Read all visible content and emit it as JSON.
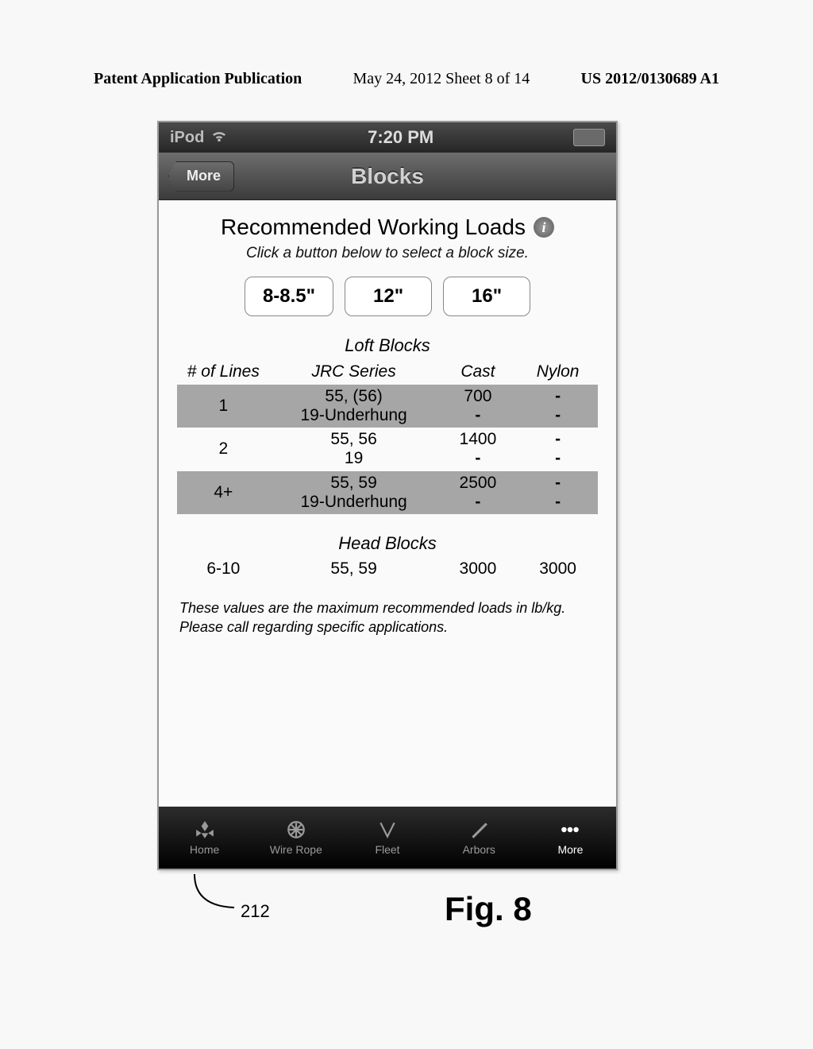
{
  "page_header": {
    "left": "Patent Application Publication",
    "center": "May 24, 2012  Sheet 8 of 14",
    "right": "US 2012/0130689 A1"
  },
  "statusbar": {
    "carrier": "iPod",
    "time": "7:20 PM"
  },
  "navbar": {
    "back": "More",
    "title": "Blocks"
  },
  "heading": "Recommended Working Loads",
  "subtitle": "Click a button below to select a block size.",
  "sizes": {
    "a": "8-8.5\"",
    "b": "12\"",
    "c": "16\""
  },
  "loft": {
    "title": "Loft Blocks",
    "cols": {
      "lines": "# of Lines",
      "jrc": "JRC Series",
      "cast": "Cast",
      "nylon": "Nylon"
    },
    "rows": [
      {
        "lines": "1",
        "jrc": "55, (56)\n19-Underhung",
        "cast_a": "700",
        "cast_b": "-",
        "nylon_a": "-",
        "nylon_b": "-"
      },
      {
        "lines": "2",
        "jrc": "55, 56\n19",
        "cast_a": "1400",
        "cast_b": "-",
        "nylon_a": "-",
        "nylon_b": "-"
      },
      {
        "lines": "4+",
        "jrc": "55, 59\n19-Underhung",
        "cast_a": "2500",
        "cast_b": "-",
        "nylon_a": "-",
        "nylon_b": "-"
      }
    ]
  },
  "head": {
    "title": "Head Blocks",
    "row": {
      "lines": "6-10",
      "jrc": "55, 59",
      "cast": "3000",
      "nylon": "3000"
    }
  },
  "footnote": "These values are the maximum recommended loads in lb/kg.  Please call regarding specific applications.",
  "tabs": {
    "home": "Home",
    "wire": "Wire Rope",
    "fleet": "Fleet",
    "arbors": "Arbors",
    "more": "More"
  },
  "callout": "212",
  "figure": "Fig. 8",
  "chart_data": {
    "type": "table",
    "title": "Recommended Working Loads — 12\" block size",
    "sections": [
      {
        "name": "Loft Blocks",
        "columns": [
          "# of Lines",
          "JRC Series",
          "Cast",
          "Nylon"
        ],
        "rows": [
          [
            "1",
            "55, (56) / 19-Underhung",
            700,
            null
          ],
          [
            "2",
            "55, 56 / 19",
            1400,
            null
          ],
          [
            "4+",
            "55, 59 / 19-Underhung",
            2500,
            null
          ]
        ]
      },
      {
        "name": "Head Blocks",
        "columns": [
          "# of Lines",
          "JRC Series",
          "Cast",
          "Nylon"
        ],
        "rows": [
          [
            "6-10",
            "55, 59",
            3000,
            3000
          ]
        ]
      }
    ],
    "units": "lb/kg"
  }
}
